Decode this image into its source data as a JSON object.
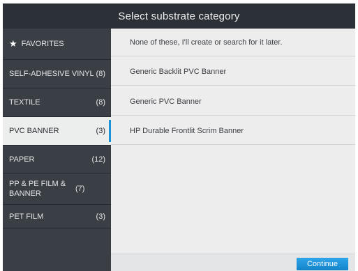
{
  "title": "Select substrate category",
  "sidebar": {
    "items": [
      {
        "label": "FAVORITES",
        "count": "",
        "icon": "star-icon"
      },
      {
        "label": "SELF-ADHESIVE VINYL",
        "count": "(8)"
      },
      {
        "label": "TEXTILE",
        "count": "(8)"
      },
      {
        "label": "PVC BANNER",
        "count": "(3)",
        "selected": true
      },
      {
        "label": "PAPER",
        "count": "(12)"
      },
      {
        "label": "PP & PE FILM & BANNER",
        "count": "(7)"
      },
      {
        "label": "PET FILM",
        "count": "(3)"
      }
    ]
  },
  "main": {
    "rows": [
      "None of these, I'll create or search for it later.",
      "Generic Backlit PVC Banner",
      "Generic PVC Banner",
      "HP Durable Frontlit Scrim Banner"
    ]
  },
  "footer": {
    "continue_label": "Continue"
  },
  "colors": {
    "accent": "#1a93d8",
    "sidebar_bg": "#3a3f46",
    "title_bg": "#2c3037",
    "content_bg": "#ededed"
  }
}
